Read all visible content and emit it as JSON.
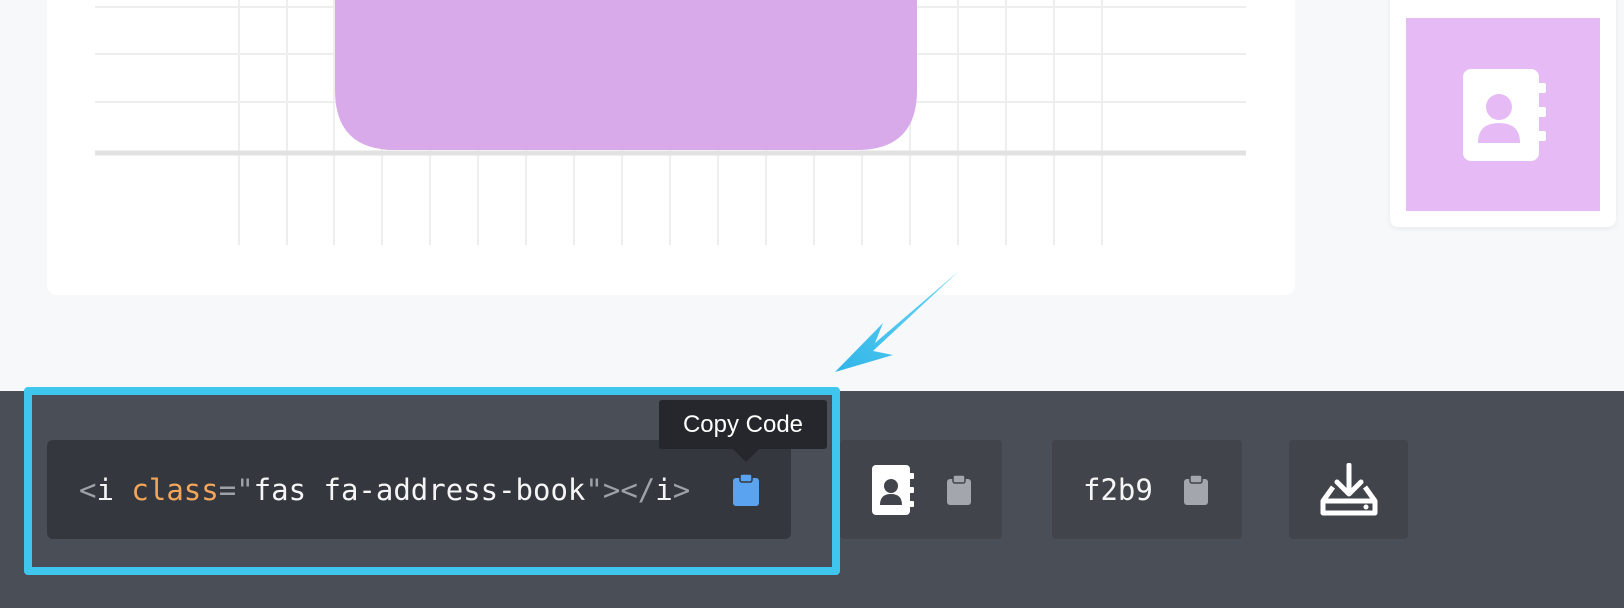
{
  "icon": {
    "name": "address-book-icon",
    "accent_color": "#d6a5e8",
    "thumb_color": "#e5baf5"
  },
  "code": {
    "open_bracket": "<",
    "tag": "i",
    "attr": "class",
    "equals": "=",
    "quote": "\"",
    "value": "fas fa-address-book",
    "close_open_tag": "></",
    "close_tag": "i",
    "close_bracket": ">"
  },
  "tooltip": {
    "label": "Copy Code"
  },
  "unicode": {
    "value": "f2b9"
  },
  "colors": {
    "highlight": "#3ec6ef",
    "bar": "#4a4e57",
    "copy_active": "#5aa3f0",
    "copy_inactive": "#a3a6ac"
  }
}
